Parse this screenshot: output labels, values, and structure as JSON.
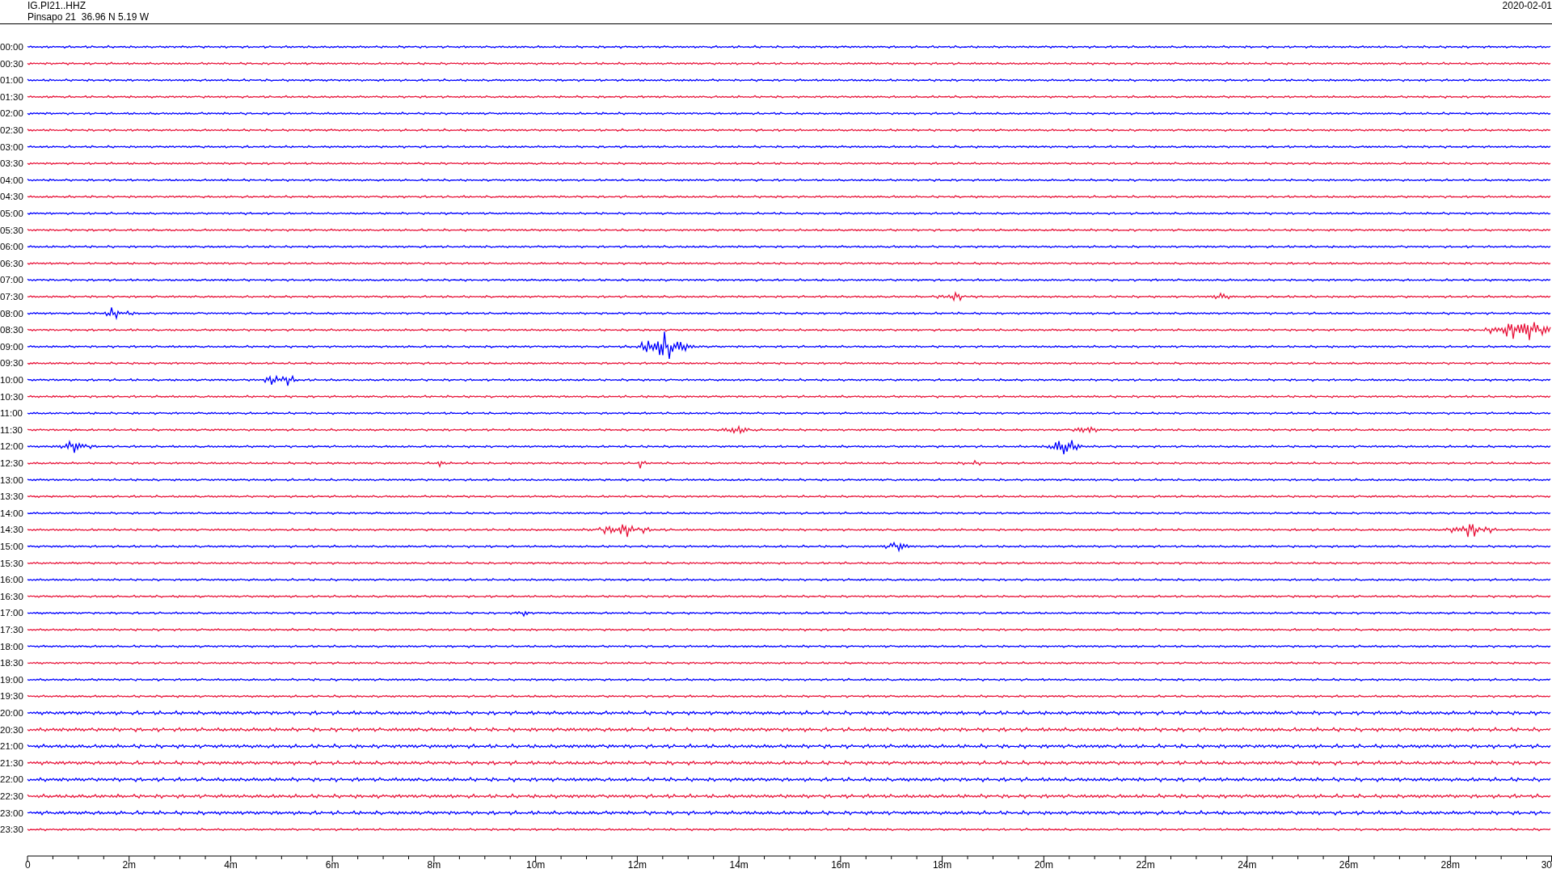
{
  "header": {
    "station": "IG.PI21..HHZ",
    "location": "Pinsapo 21  36.96 N 5.19 W",
    "date": "2020-02-01"
  },
  "rows": [
    {
      "time": "00:00",
      "color": "#0000ff"
    },
    {
      "time": "00:30",
      "color": "#e8163c"
    },
    {
      "time": "01:00",
      "color": "#0000ff"
    },
    {
      "time": "01:30",
      "color": "#e8163c"
    },
    {
      "time": "02:00",
      "color": "#0000ff"
    },
    {
      "time": "02:30",
      "color": "#e8163c"
    },
    {
      "time": "03:00",
      "color": "#0000ff"
    },
    {
      "time": "03:30",
      "color": "#e8163c"
    },
    {
      "time": "04:00",
      "color": "#0000ff"
    },
    {
      "time": "04:30",
      "color": "#e8163c"
    },
    {
      "time": "05:00",
      "color": "#0000ff"
    },
    {
      "time": "05:30",
      "color": "#e8163c"
    },
    {
      "time": "06:00",
      "color": "#0000ff"
    },
    {
      "time": "06:30",
      "color": "#e8163c"
    },
    {
      "time": "07:00",
      "color": "#0000ff"
    },
    {
      "time": "07:30",
      "color": "#e8163c"
    },
    {
      "time": "08:00",
      "color": "#0000ff"
    },
    {
      "time": "08:30",
      "color": "#e8163c"
    },
    {
      "time": "09:00",
      "color": "#0000ff"
    },
    {
      "time": "09:30",
      "color": "#e8163c"
    },
    {
      "time": "10:00",
      "color": "#0000ff"
    },
    {
      "time": "10:30",
      "color": "#e8163c"
    },
    {
      "time": "11:00",
      "color": "#0000ff"
    },
    {
      "time": "11:30",
      "color": "#e8163c"
    },
    {
      "time": "12:00",
      "color": "#0000ff"
    },
    {
      "time": "12:30",
      "color": "#e8163c"
    },
    {
      "time": "13:00",
      "color": "#0000ff"
    },
    {
      "time": "13:30",
      "color": "#e8163c"
    },
    {
      "time": "14:00",
      "color": "#0000ff"
    },
    {
      "time": "14:30",
      "color": "#e8163c"
    },
    {
      "time": "15:00",
      "color": "#0000ff"
    },
    {
      "time": "15:30",
      "color": "#e8163c"
    },
    {
      "time": "16:00",
      "color": "#0000ff"
    },
    {
      "time": "16:30",
      "color": "#e8163c"
    },
    {
      "time": "17:00",
      "color": "#0000ff"
    },
    {
      "time": "17:30",
      "color": "#e8163c"
    },
    {
      "time": "18:00",
      "color": "#0000ff"
    },
    {
      "time": "18:30",
      "color": "#e8163c"
    },
    {
      "time": "19:00",
      "color": "#0000ff"
    },
    {
      "time": "19:30",
      "color": "#e8163c"
    },
    {
      "time": "20:00",
      "color": "#0000ff"
    },
    {
      "time": "20:30",
      "color": "#e8163c"
    },
    {
      "time": "21:00",
      "color": "#0000ff"
    },
    {
      "time": "21:30",
      "color": "#e8163c"
    },
    {
      "time": "22:00",
      "color": "#0000ff"
    },
    {
      "time": "22:30",
      "color": "#e8163c"
    },
    {
      "time": "23:00",
      "color": "#0000ff"
    },
    {
      "time": "23:30",
      "color": "#e8163c"
    }
  ],
  "x_axis": {
    "labels": [
      "0",
      "2m",
      "4m",
      "6m",
      "8m",
      "10m",
      "12m",
      "14m",
      "16m",
      "18m",
      "20m",
      "22m",
      "24m",
      "26m",
      "28m",
      "30"
    ]
  }
}
